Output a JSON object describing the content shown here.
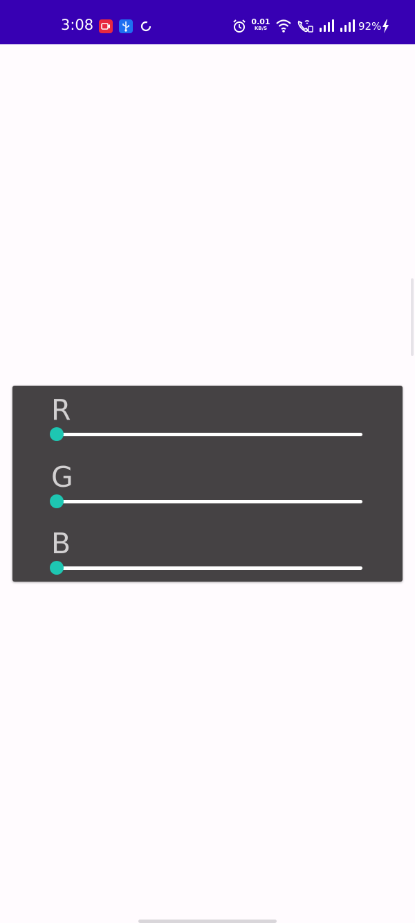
{
  "status_bar": {
    "time": "3:08",
    "net_speed_value": "0.01",
    "net_speed_unit": "KB/S",
    "battery": "92%",
    "icons": [
      "screen-recorder-icon",
      "usb-debug-icon",
      "sync-icon",
      "alarm-icon",
      "wifi-icon",
      "wifi-calling-icon",
      "signal-icon",
      "signal-icon",
      "charging-icon"
    ],
    "colors": {
      "background": "#3700b3",
      "recorder": "#e8293f",
      "usb": "#1e6ff1"
    }
  },
  "color_panel": {
    "background": "#454244",
    "accent": "#1ec6b2",
    "channels": [
      {
        "label": "R",
        "value_fraction": 0.0
      },
      {
        "label": "G",
        "value_fraction": 0.0
      },
      {
        "label": "B",
        "value_fraction": 0.0
      }
    ]
  }
}
